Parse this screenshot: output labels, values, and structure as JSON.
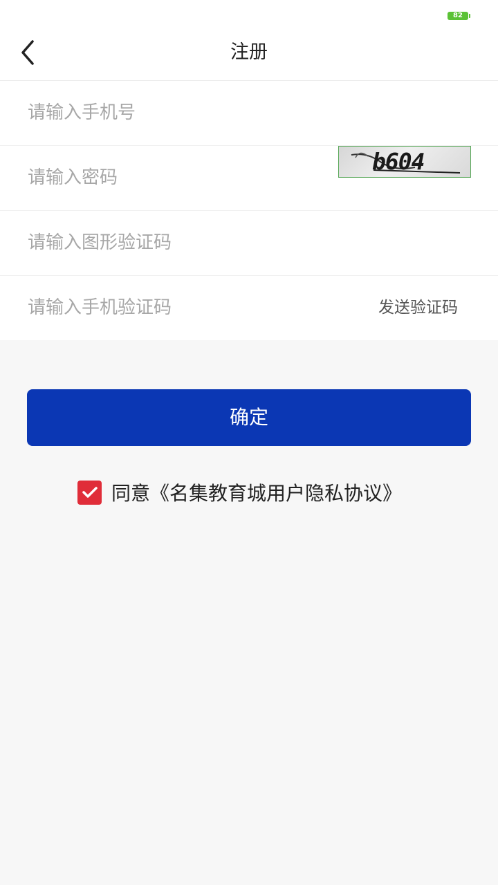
{
  "status_bar": {
    "battery_level": "82",
    "battery_color": "#5bc236"
  },
  "header": {
    "back_icon": "chevron-left-icon",
    "title": "注册"
  },
  "form": {
    "phone_placeholder": "请输入手机号",
    "password_placeholder": "请输入密码",
    "captcha_placeholder": "请输入图形验证码",
    "captcha_text": "b604",
    "sms_code_placeholder": "请输入手机验证码",
    "send_code_label": "发送验证码"
  },
  "confirm": {
    "label": "确定",
    "color": "#0b37b4"
  },
  "agreement": {
    "checked": true,
    "check_icon": "checkmark-icon",
    "checkbox_color": "#e02d39",
    "text": "同意《名集教育城用户隐私协议》"
  }
}
